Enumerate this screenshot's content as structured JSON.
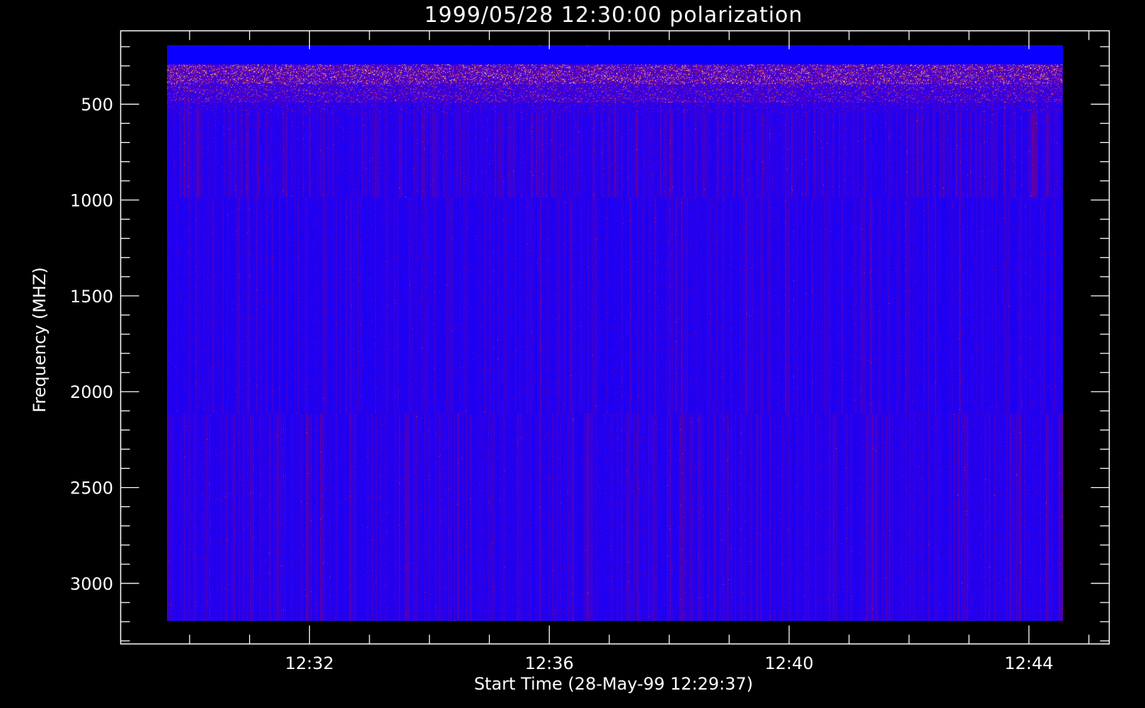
{
  "chart_data": {
    "type": "heatmap",
    "title": "1999/05/28 12:30:00 polarization",
    "xlabel": "Start Time (28-May-99 12:29:37)",
    "ylabel": "Frequency (MHZ)",
    "x_tick_labels": [
      "12:32",
      "12:36",
      "12:40",
      "12:44"
    ],
    "x_ticks_minutes": [
      2.38,
      6.38,
      10.38,
      14.38
    ],
    "x_range_minutes": [
      -0.77,
      15.72
    ],
    "x_data_range_minutes": [
      0.0,
      14.95
    ],
    "y_tick_labels": [
      "500",
      "1000",
      "1500",
      "2000",
      "2500",
      "3000"
    ],
    "y_ticks": [
      500,
      1000,
      1500,
      2000,
      2500,
      3000
    ],
    "y_range": [
      117,
      3316
    ],
    "y_data_range": [
      193,
      3196
    ],
    "y_inverted": true,
    "colormap": [
      "#0a00ff",
      "#3a00e0",
      "#7a0080",
      "#d0206a",
      "#ff9040",
      "#ffe0a0"
    ],
    "bands": [
      {
        "from": 193,
        "to": 290,
        "level": 0.0,
        "noise": 0.0,
        "streak": 0.0
      },
      {
        "from": 290,
        "to": 395,
        "level": 0.45,
        "noise": 0.55,
        "streak": 0.05
      },
      {
        "from": 395,
        "to": 490,
        "level": 0.28,
        "noise": 0.35,
        "streak": 0.12
      },
      {
        "from": 490,
        "to": 545,
        "level": 0.12,
        "noise": 0.2,
        "streak": 0.25
      },
      {
        "from": 545,
        "to": 985,
        "level": 0.06,
        "noise": 0.04,
        "streak": 0.5
      },
      {
        "from": 985,
        "to": 2110,
        "level": 0.05,
        "noise": 0.03,
        "streak": 0.42
      },
      {
        "from": 2110,
        "to": 3196,
        "level": 0.05,
        "noise": 0.03,
        "streak": 0.48
      }
    ]
  }
}
